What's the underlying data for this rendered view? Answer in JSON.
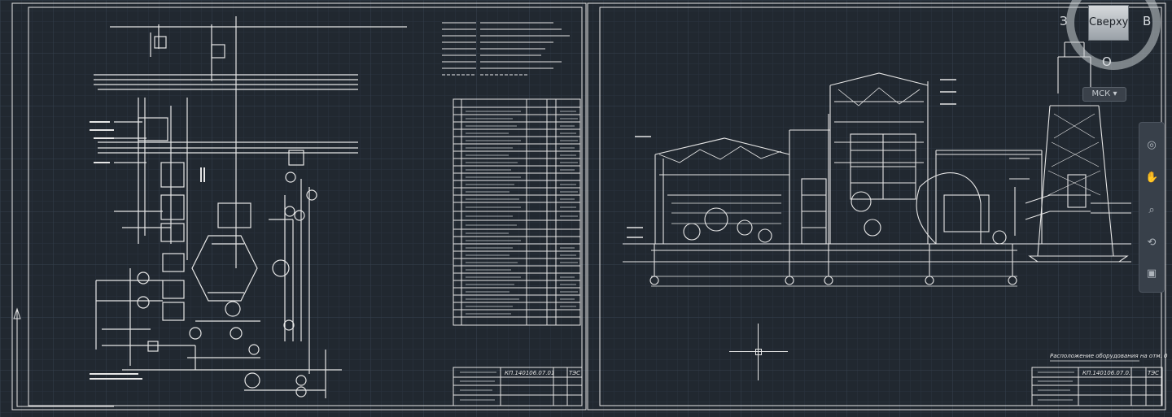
{
  "viewcube": {
    "face_label": "Сверху",
    "west": "З",
    "east": "В",
    "north": "О"
  },
  "ucs_menu": {
    "label": "МСК",
    "caret": "▾"
  },
  "navbar": {
    "tools": [
      {
        "name": "steering-wheel-icon",
        "glyph": "◎"
      },
      {
        "name": "pan-icon",
        "glyph": "✋"
      },
      {
        "name": "zoom-icon",
        "glyph": "⌕"
      },
      {
        "name": "orbit-icon",
        "glyph": "⟲"
      },
      {
        "name": "showmotion-icon",
        "glyph": "▣"
      }
    ]
  },
  "sheet_left": {
    "stamp_code": "КП.140106.07.01.000 ТЭ",
    "stamp_sheet": "ТЭС"
  },
  "sheet_right": {
    "stamp_code": "КП.140106.07.02.000",
    "stamp_sheet": "ТЭС",
    "note_label": "Расположение оборудования на отм. 0"
  },
  "colors": {
    "background": "#212830",
    "grid_minor": "#2b3440",
    "grid_major": "#34404e",
    "line": "#e8e8e8",
    "frame": "#d4d8dc"
  }
}
